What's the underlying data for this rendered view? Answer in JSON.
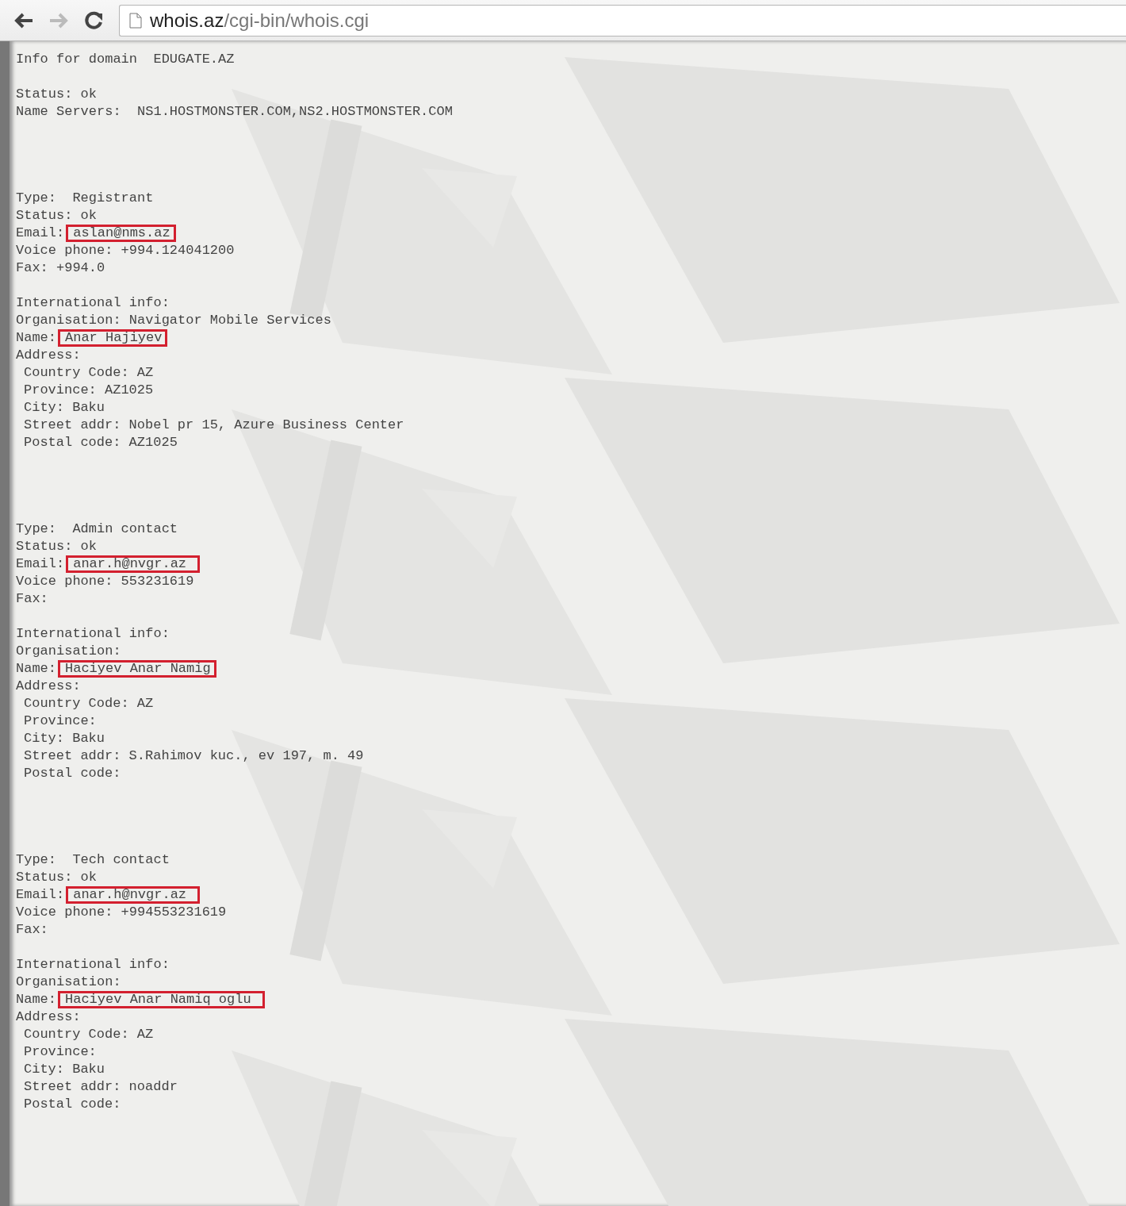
{
  "browser": {
    "url_host": "whois.az",
    "url_path": "/cgi-bin/whois.cgi"
  },
  "blocks": [
    {
      "groups": [
        [
          {
            "text": "Info for domain  EDUGATE.AZ"
          }
        ],
        [
          {
            "text": "Status: ok"
          },
          {
            "text": "Name Servers:  NS1.HOSTMONSTER.COM,NS2.HOSTMONSTER.COM"
          }
        ]
      ]
    },
    {
      "groups": [
        [
          {
            "text": "Type:  Registrant"
          },
          {
            "text": "Status: ok"
          },
          {
            "label": "Email:",
            "value": "aslan@nms.az",
            "highlighted": true
          },
          {
            "text": "Voice phone: +994.124041200"
          },
          {
            "text": "Fax: +994.0"
          }
        ],
        [
          {
            "text": "International info:"
          },
          {
            "text": "Organisation: Navigator Mobile Services"
          },
          {
            "label": "Name:",
            "value": "Anar Hajiyev",
            "highlighted": true
          },
          {
            "text": "Address:",
            "children": [
              {
                "text": "Country Code: AZ"
              },
              {
                "text": "Province: AZ1025"
              },
              {
                "text": "City: Baku"
              },
              {
                "text": "Street addr: Nobel pr 15, Azure Business Center"
              },
              {
                "text": "Postal code: AZ1025"
              }
            ]
          }
        ]
      ]
    },
    {
      "groups": [
        [
          {
            "text": "Type:  Admin contact"
          },
          {
            "text": "Status: ok"
          },
          {
            "label": "Email:",
            "value": "anar.h@nvgr.az ",
            "highlighted": true
          },
          {
            "text": "Voice phone: 553231619"
          },
          {
            "text": "Fax:"
          }
        ],
        [
          {
            "text": "International info:"
          },
          {
            "text": "Organisation:"
          },
          {
            "label": "Name:",
            "value": "Haciyev Anar Namig",
            "highlighted": true
          },
          {
            "text": "Address:",
            "children": [
              {
                "text": "Country Code: AZ"
              },
              {
                "text": "Province:"
              },
              {
                "text": "City: Baku"
              },
              {
                "text": "Street addr: S.Rahimov kuc., ev 197, m. 49"
              },
              {
                "text": "Postal code:"
              }
            ]
          }
        ]
      ]
    },
    {
      "groups": [
        [
          {
            "text": "Type:  Tech contact"
          },
          {
            "text": "Status: ok"
          },
          {
            "label": "Email:",
            "value": "anar.h@nvgr.az ",
            "highlighted": true
          },
          {
            "text": "Voice phone: +994553231619"
          },
          {
            "text": "Fax:"
          }
        ],
        [
          {
            "text": "International info:"
          },
          {
            "text": "Organisation:"
          },
          {
            "label": "Name:",
            "value": "Haciyev Anar Namiq oglu ",
            "highlighted": true
          },
          {
            "text": "Address:",
            "children": [
              {
                "text": "Country Code: AZ"
              },
              {
                "text": "Province:"
              },
              {
                "text": "City: Baku"
              },
              {
                "text": "Street addr: noaddr"
              },
              {
                "text": "Postal code:"
              }
            ]
          }
        ]
      ]
    }
  ]
}
